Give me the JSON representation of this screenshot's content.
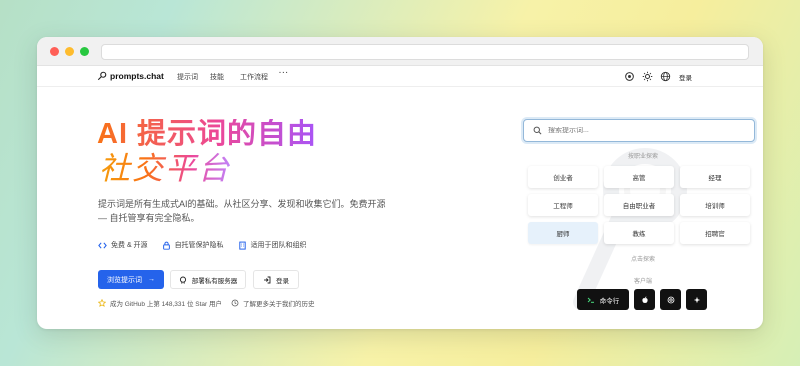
{
  "nav": {
    "brand": "prompts.chat",
    "links": [
      "提示词",
      "技能",
      "工作流程"
    ],
    "more": "···",
    "login": "登录"
  },
  "hero": {
    "title_line1": "AI 提示词的自由",
    "title_line2": "社交平台",
    "description": "提示词是所有生成式AI的基础。从社区分享、发现和收集它们。免费开源 — 自托管享有完全隐私。",
    "features": [
      "免费 & 开源",
      "自托管保护隐私",
      "适用于团队和组织"
    ],
    "primary_button": "浏览提示词",
    "deploy_button": "部署私有服务器",
    "login_button": "登录",
    "github_stat": "成为 GitHub 上第 148,331 位 Star 用户",
    "history_link": "了解更多关于我们的历史"
  },
  "search": {
    "placeholder": "搜索提示词..."
  },
  "explore": {
    "industry_label": "按职业探索",
    "chips": [
      "创业者",
      "高管",
      "经理",
      "工程师",
      "自由职业者",
      "培训师",
      "厨师",
      "教练",
      "招聘官"
    ],
    "active_chip": "厨师",
    "click_label": "点击探索"
  },
  "clients": {
    "label": "客户端",
    "cli_button": "命令行"
  },
  "colors": {
    "primary": "#2563eb",
    "title_gradient": [
      "#f97316",
      "#ec4899",
      "#a855f7"
    ]
  }
}
